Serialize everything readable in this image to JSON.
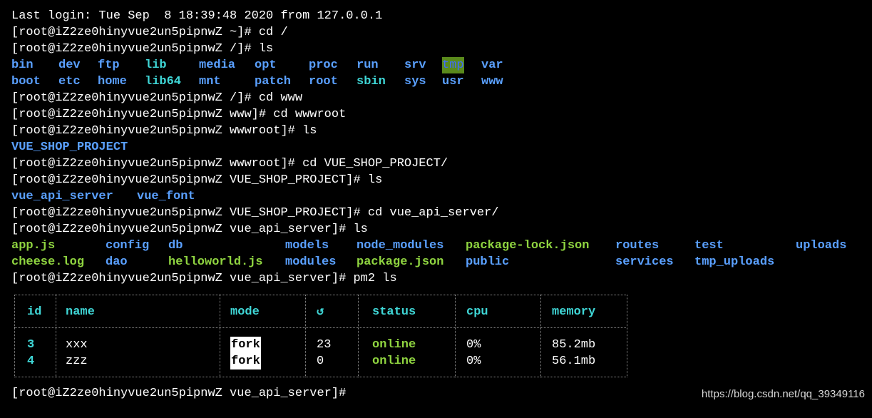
{
  "terminal": {
    "last_login": "Last login: Tue Sep  8 18:39:48 2020 from 127.0.0.1",
    "prompts": [
      "[root@iZ2ze0hinyvue2un5pipnwZ ~]# cd /",
      "[root@iZ2ze0hinyvue2un5pipnwZ /]# ls",
      "[root@iZ2ze0hinyvue2un5pipnwZ /]# cd www",
      "[root@iZ2ze0hinyvue2un5pipnwZ www]# cd wwwroot",
      "[root@iZ2ze0hinyvue2un5pipnwZ wwwroot]# ls",
      "[root@iZ2ze0hinyvue2un5pipnwZ wwwroot]# cd VUE_SHOP_PROJECT/",
      "[root@iZ2ze0hinyvue2un5pipnwZ VUE_SHOP_PROJECT]# ls",
      "[root@iZ2ze0hinyvue2un5pipnwZ VUE_SHOP_PROJECT]# cd vue_api_server/",
      "[root@iZ2ze0hinyvue2un5pipnwZ vue_api_server]# ls",
      "[root@iZ2ze0hinyvue2un5pipnwZ vue_api_server]# pm2 ls",
      "[root@iZ2ze0hinyvue2un5pipnwZ vue_api_server]#"
    ],
    "root_ls": {
      "row1": [
        "bin",
        "dev",
        "ftp",
        "lib",
        "media",
        "opt",
        "proc",
        "run",
        "srv",
        "tmp",
        "var"
      ],
      "row2": [
        "boot",
        "etc",
        "home",
        "lib64",
        "mnt",
        "patch",
        "root",
        "sbin",
        "sys",
        "usr",
        "www"
      ]
    },
    "wwwroot_ls": [
      "VUE_SHOP_PROJECT"
    ],
    "project_ls": [
      "vue_api_server",
      "vue_font"
    ],
    "server_ls": {
      "row1": [
        "app.js",
        "config",
        "db",
        "models",
        "node_modules",
        "package-lock.json",
        "routes",
        "test",
        "uploads"
      ],
      "row2": [
        "cheese.log",
        "dao",
        "helloworld.js",
        "modules",
        "package.json",
        "public",
        "services",
        "tmp_uploads"
      ]
    },
    "pm2_table": {
      "headers": [
        "id",
        "name",
        "mode",
        "↺",
        "status",
        "cpu",
        "memory"
      ],
      "rows": [
        {
          "id": "3",
          "name": "xxx",
          "mode": "fork",
          "restarts": "23",
          "status": "online",
          "cpu": "0%",
          "memory": "85.2mb"
        },
        {
          "id": "4",
          "name": "zzz",
          "mode": "fork",
          "restarts": "0",
          "status": "online",
          "cpu": "0%",
          "memory": "56.1mb"
        }
      ]
    }
  },
  "watermark": "https://blog.csdn.net/qq_39349116",
  "colors": {
    "dir": "#5aa0ff",
    "symlink": "#3fd6d6",
    "exec": "#8fd440",
    "tmp_bg": "#5a8a1c"
  }
}
